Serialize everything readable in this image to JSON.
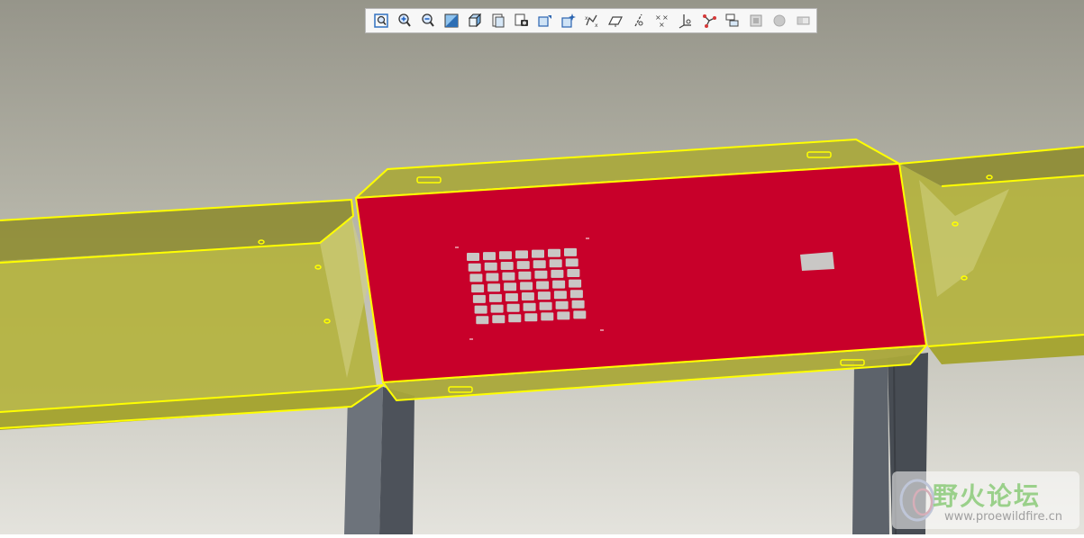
{
  "toolbar": {
    "icons": [
      "zoom-fit-icon",
      "zoom-in-icon",
      "zoom-out-icon",
      "repaint-icon",
      "view-orientation-icon",
      "saved-views-icon",
      "display-style-icon",
      "spin-center-icon",
      "datum-display-icon",
      "plane-display-icon",
      "axis-display-icon",
      "point-display-icon",
      "csys-display-icon",
      "annotation-display-icon",
      "model-tree-icon",
      "layer-icon",
      "render-icon",
      "close-view-icon"
    ]
  },
  "model": {
    "part_color": "#c8002a",
    "frame_color": "#b9b83a",
    "edge_color": "#ffff00",
    "leg_color": "#5a5f66",
    "hole_color": "#c9c7c5",
    "hole_grid": {
      "rows": 7,
      "cols": 7
    }
  },
  "watermark": {
    "title": "野火论坛",
    "url": "www.proewildfire.cn"
  }
}
